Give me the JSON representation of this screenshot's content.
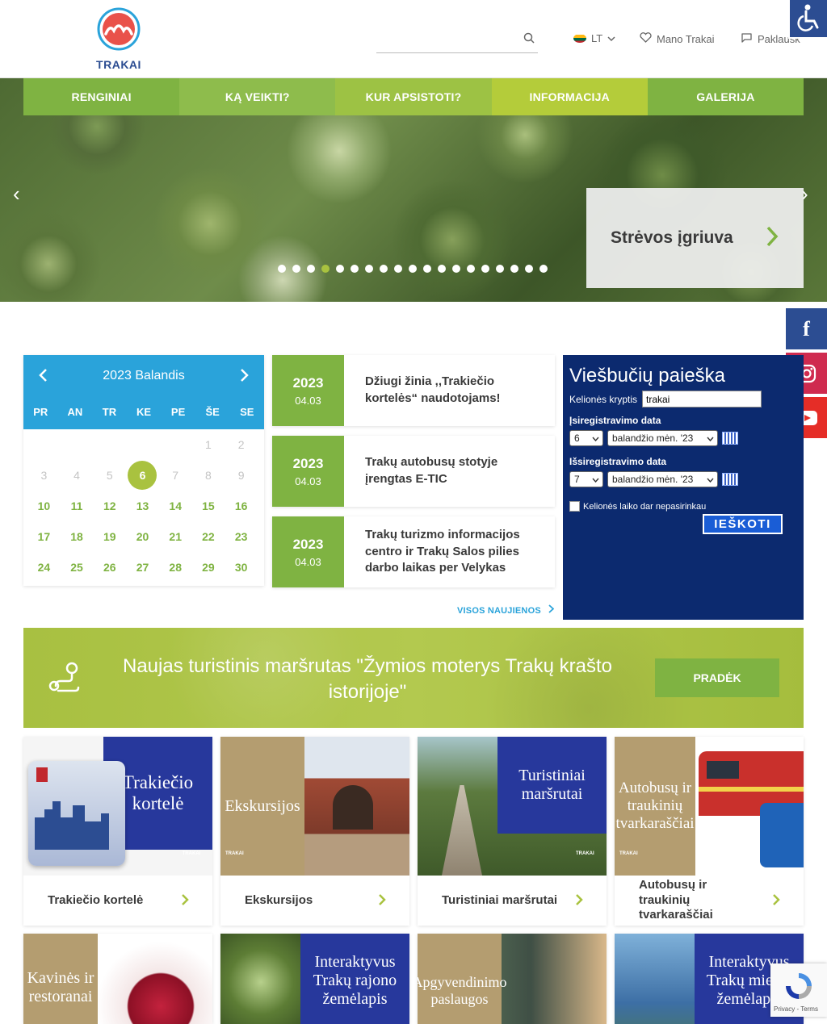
{
  "header": {
    "logo_text": "TRAKAI",
    "search_placeholder": "",
    "language": "LT",
    "mano_trakai": "Mano Trakai",
    "paklausk": "Paklausk"
  },
  "nav": [
    {
      "label": "RENGINIAI",
      "color": "#7fb342"
    },
    {
      "label": "KĄ VEIKTI?",
      "color": "#8ebc4c"
    },
    {
      "label": "KUR APSISTOTI?",
      "color": "#9dc244"
    },
    {
      "label": "INFORMACIJA",
      "color": "#b4cc3a"
    },
    {
      "label": "GALERIJA",
      "color": "#7fb342"
    }
  ],
  "hero": {
    "slide_title": "Strėvos įgriuva",
    "dots_total": 19,
    "active_dot": 4
  },
  "calendar": {
    "title": "2023 Balandis",
    "weekdays": [
      "PR",
      "AN",
      "TR",
      "KE",
      "PE",
      "ŠE",
      "SE"
    ],
    "prev_month_days": [
      "",
      "",
      "",
      "",
      "",
      "1",
      "2",
      "3",
      "4",
      "5"
    ],
    "today": "6",
    "days": [
      "7",
      "8",
      "9",
      "10",
      "11",
      "12",
      "13",
      "14",
      "15",
      "16",
      "17",
      "18",
      "19",
      "20",
      "21",
      "22",
      "23",
      "24",
      "25",
      "26",
      "27",
      "28",
      "29",
      "30"
    ],
    "dimmed_days": [
      "7",
      "8",
      "9"
    ]
  },
  "news": [
    {
      "year": "2023",
      "date": "04.03",
      "title": "Džiugi žinia ,,Trakiečio kortelės“ naudotojams!"
    },
    {
      "year": "2023",
      "date": "04.03",
      "title": "Trakų autobusų stotyje įrengtas E-TIC"
    },
    {
      "year": "2023",
      "date": "04.03",
      "title": "Trakų turizmo informacijos centro ir Trakų Salos pilies darbo laikas per Velykas"
    }
  ],
  "all_news": "VISOS NAUJIENOS",
  "hotel_search": {
    "title": "Viešbučių paieška",
    "destination_label": "Kelionės kryptis",
    "destination_value": "trakai",
    "checkin_label": "Įsiregistravimo data",
    "checkin_day": "6",
    "checkin_month": "balandžio mėn. '23",
    "checkout_label": "Išsiregistravimo data",
    "checkout_day": "7",
    "checkout_month": "balandžio mėn. '23",
    "undecided_label": "Kelionės laiko dar nepasirinkau",
    "search_button": "IEŠKOTI"
  },
  "route_banner": {
    "text": "Naujas turistinis maršrutas \"Žymios moterys Trakų krašto istorijoje\"",
    "button": "PRADĖK"
  },
  "tiles": [
    {
      "caption": "Trakiečio kortelė",
      "image_text": "Trakiečio kortelė"
    },
    {
      "caption": "Ekskursijos",
      "image_text": "Ekskursijos"
    },
    {
      "caption": "Turistiniai maršrutai",
      "image_text": "Turistiniai maršrutai"
    },
    {
      "caption": "Autobusų ir traukinių tvarkaraščiai",
      "image_text": "Autobusų ir traukinių tvarkaraščiai"
    }
  ],
  "tiles_row2": [
    {
      "image_text": "Kavinės ir restoranai"
    },
    {
      "image_text": "Interaktyvus Trakų rajono žemėlapis"
    },
    {
      "image_text": "Apgyvendinimo paslaugos"
    },
    {
      "image_text": "Interaktyvus Trakų miesto žemėlapis"
    }
  ],
  "recaptcha": "Privacy - Terms",
  "brand_badge": "TRAKAI"
}
